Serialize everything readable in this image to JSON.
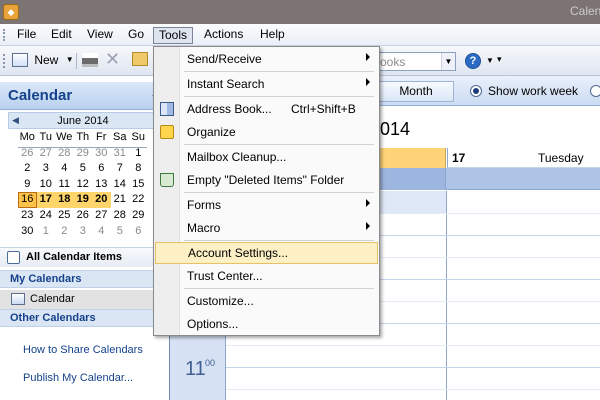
{
  "window": {
    "title": "Calendar",
    "icon": "outlook-icon"
  },
  "menu": {
    "file": "File",
    "edit": "Edit",
    "view": "View",
    "go": "Go",
    "tools": "Tools",
    "actions": "Actions",
    "help": "Help"
  },
  "toolbar": {
    "new_label": "New",
    "search_placeholder": "ooks"
  },
  "tools_menu": {
    "send_receive": "Send/Receive",
    "instant_search": "Instant Search",
    "address_book": "Address Book...",
    "address_book_shortcut": "Ctrl+Shift+B",
    "organize": "Organize",
    "mailbox_cleanup": "Mailbox Cleanup...",
    "empty_deleted": "Empty \"Deleted Items\" Folder",
    "forms": "Forms",
    "macro": "Macro",
    "account_settings": "Account Settings...",
    "trust_center": "Trust Center...",
    "customize": "Customize...",
    "options": "Options..."
  },
  "nav": {
    "title": "Calendar",
    "mini_calendar": {
      "month": "June 2014",
      "weekdays": [
        "Mo",
        "Tu",
        "We",
        "Th",
        "Fr",
        "Sa",
        "Su"
      ],
      "weeks": [
        [
          "26",
          "27",
          "28",
          "29",
          "30",
          "31",
          "1"
        ],
        [
          "2",
          "3",
          "4",
          "5",
          "6",
          "7",
          "8"
        ],
        [
          "9",
          "10",
          "11",
          "12",
          "13",
          "14",
          "15"
        ],
        [
          "16",
          "17",
          "18",
          "19",
          "20",
          "21",
          "22"
        ],
        [
          "23",
          "24",
          "25",
          "26",
          "27",
          "28",
          "29"
        ],
        [
          "30",
          "1",
          "2",
          "3",
          "4",
          "5",
          "6"
        ]
      ],
      "today": "16",
      "selected_range": [
        "16",
        "17",
        "18",
        "19",
        "20"
      ]
    },
    "all_calendar_items": "All Calendar Items",
    "my_calendars": "My Calendars",
    "calendar_item": "Calendar",
    "other_calendars": "Other Calendars",
    "link_share": "How to Share Calendars",
    "link_publish": "Publish My Calendar..."
  },
  "calendar": {
    "tab_month": "Month",
    "show_work_week": "Show work week",
    "date_title_fragment": "014",
    "day_17_num": "17",
    "day_17_name": "Tuesday",
    "time_hour": "11",
    "time_minutes": "00"
  },
  "colors": {
    "accent": "#15428b",
    "menu_highlight": "#fdf0c4",
    "today": "#ffc34a",
    "selection": "#ffd46b"
  }
}
